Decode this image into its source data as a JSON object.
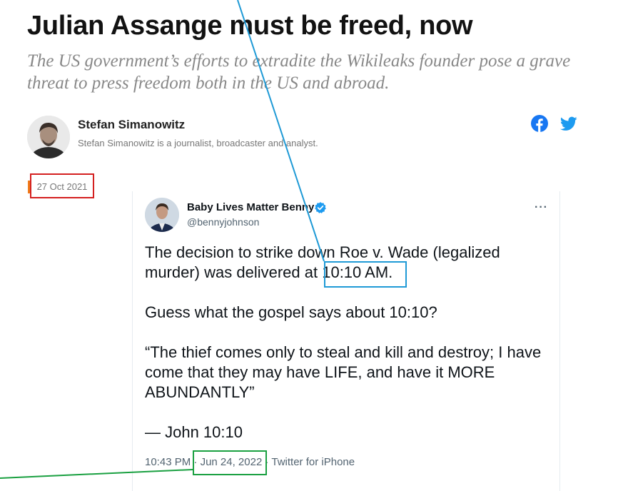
{
  "article": {
    "headline": "Julian Assange must be freed, now",
    "standfirst": "The US government’s efforts to extradite the Wikileaks founder pose a grave threat to press freedom both in the US and abroad.",
    "author_name": "Stefan Simanowitz",
    "author_bio": "Stefan Simanowitz is a journalist, broadcaster and analyst.",
    "date": "27 Oct 2021"
  },
  "share": {
    "facebook_icon": "facebook-icon",
    "twitter_icon": "twitter-icon"
  },
  "tweet": {
    "display_name": "Baby Lives Matter Benny",
    "handle": "@bennyjohnson",
    "more": "···",
    "body_line1_pre": "The decision to strike down Roe v. Wade (legalized murder) was delivered at ",
    "body_line1_time": "10:10 AM.",
    "body_p2": "Guess what the gospel says about 10:10?",
    "body_p3": "“The thief comes only to steal and kill and destroy; I have come that they may have LIFE, and have it MORE ABUNDANTLY”",
    "body_p4": "— John 10:10",
    "time": "10:43 PM",
    "separator": " · ",
    "date": "Jun 24, 2022",
    "source": "Twitter for iPhone"
  },
  "colors": {
    "annotation_red": "#d42020",
    "annotation_blue": "#1f9ad6",
    "annotation_green": "#1aa041",
    "twitter_blue": "#1d9bf0",
    "facebook_blue": "#1877f2",
    "date_accent": "#f07c1c"
  }
}
